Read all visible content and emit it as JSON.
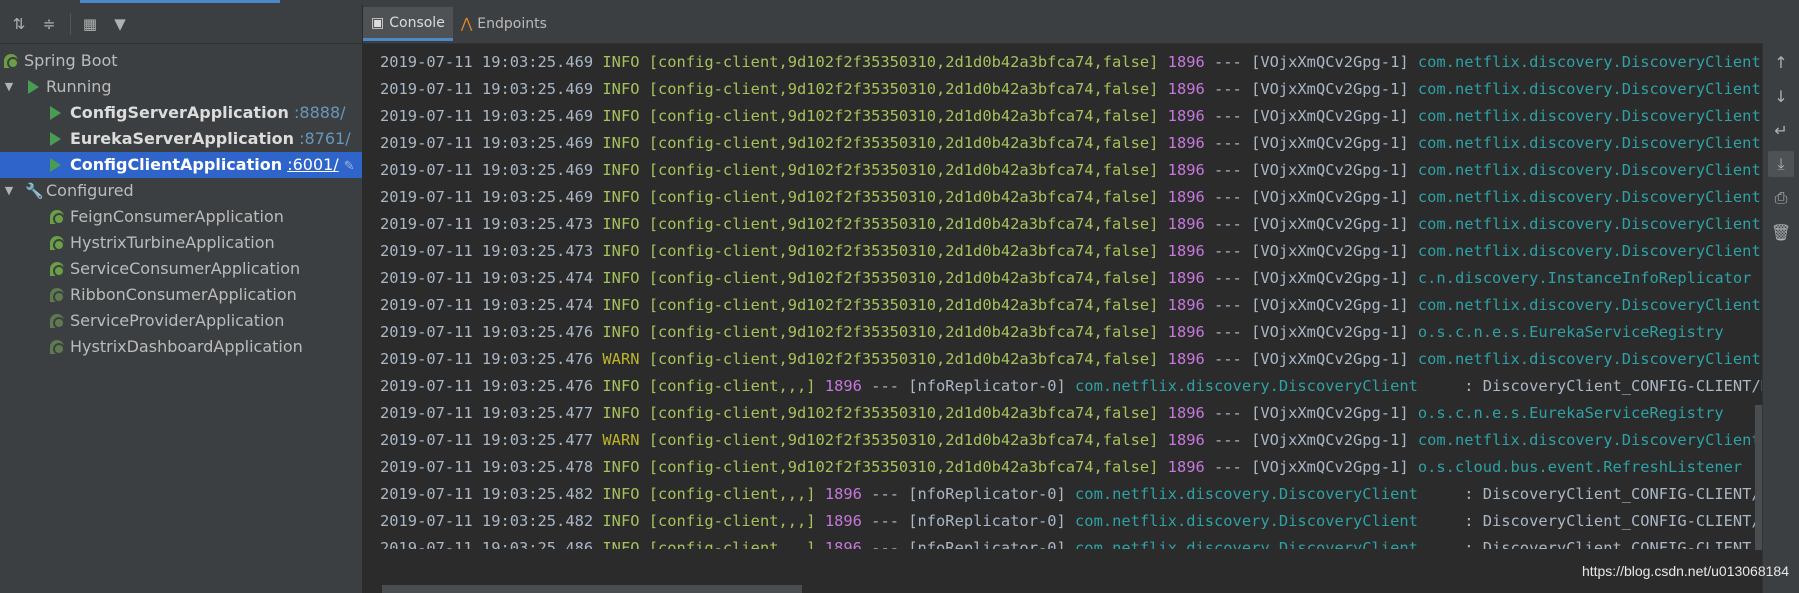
{
  "run_dashboard": {
    "toolbar": {
      "expand_all_icon": "expand-all-icon",
      "collapse_all_icon": "collapse-all-icon",
      "group_icon": "group-by-icon",
      "filter_icon": "filter-icon"
    },
    "root_label": "Spring Boot",
    "running_label": "Running",
    "running_apps": [
      {
        "name": "ConfigServerApplication",
        "port": ":8888/"
      },
      {
        "name": "EurekaServerApplication",
        "port": ":8761/"
      },
      {
        "name": "ConfigClientApplication",
        "port": ":6001/"
      }
    ],
    "configured_label": "Configured",
    "configured_apps": [
      "FeignConsumerApplication",
      "HystrixTurbineApplication",
      "ServiceConsumerApplication",
      "RibbonConsumerApplication",
      "ServiceProviderApplication",
      "HystrixDashboardApplication"
    ]
  },
  "console": {
    "tabs": [
      {
        "label": "Console",
        "icon": "console-icon"
      },
      {
        "label": "Endpoints",
        "icon": "endpoints-icon"
      }
    ],
    "lines": [
      {
        "ts": "2019-07-11 19:03:25.469",
        "level": "INFO ",
        "ctx": "[config-client,9d102f2f35350310,2d1d0b42a3bfca74,false]",
        "pid": "1896",
        "th": " --- [VOjxXmQCv2Gpg-1] ",
        "cls": "com.netflix.discovery.DiscoveryClient",
        "msg": ""
      },
      {
        "ts": "2019-07-11 19:03:25.469",
        "level": "INFO ",
        "ctx": "[config-client,9d102f2f35350310,2d1d0b42a3bfca74,false]",
        "pid": "1896",
        "th": " --- [VOjxXmQCv2Gpg-1] ",
        "cls": "com.netflix.discovery.DiscoveryClient",
        "msg": ""
      },
      {
        "ts": "2019-07-11 19:03:25.469",
        "level": "INFO ",
        "ctx": "[config-client,9d102f2f35350310,2d1d0b42a3bfca74,false]",
        "pid": "1896",
        "th": " --- [VOjxXmQCv2Gpg-1] ",
        "cls": "com.netflix.discovery.DiscoveryClient",
        "msg": ""
      },
      {
        "ts": "2019-07-11 19:03:25.469",
        "level": "INFO ",
        "ctx": "[config-client,9d102f2f35350310,2d1d0b42a3bfca74,false]",
        "pid": "1896",
        "th": " --- [VOjxXmQCv2Gpg-1] ",
        "cls": "com.netflix.discovery.DiscoveryClient",
        "msg": ""
      },
      {
        "ts": "2019-07-11 19:03:25.469",
        "level": "INFO ",
        "ctx": "[config-client,9d102f2f35350310,2d1d0b42a3bfca74,false]",
        "pid": "1896",
        "th": " --- [VOjxXmQCv2Gpg-1] ",
        "cls": "com.netflix.discovery.DiscoveryClient",
        "msg": ""
      },
      {
        "ts": "2019-07-11 19:03:25.469",
        "level": "INFO ",
        "ctx": "[config-client,9d102f2f35350310,2d1d0b42a3bfca74,false]",
        "pid": "1896",
        "th": " --- [VOjxXmQCv2Gpg-1] ",
        "cls": "com.netflix.discovery.DiscoveryClient",
        "msg": ""
      },
      {
        "ts": "2019-07-11 19:03:25.473",
        "level": "INFO ",
        "ctx": "[config-client,9d102f2f35350310,2d1d0b42a3bfca74,false]",
        "pid": "1896",
        "th": " --- [VOjxXmQCv2Gpg-1] ",
        "cls": "com.netflix.discovery.DiscoveryClient",
        "msg": ""
      },
      {
        "ts": "2019-07-11 19:03:25.473",
        "level": "INFO ",
        "ctx": "[config-client,9d102f2f35350310,2d1d0b42a3bfca74,false]",
        "pid": "1896",
        "th": " --- [VOjxXmQCv2Gpg-1] ",
        "cls": "com.netflix.discovery.DiscoveryClient",
        "msg": ""
      },
      {
        "ts": "2019-07-11 19:03:25.474",
        "level": "INFO ",
        "ctx": "[config-client,9d102f2f35350310,2d1d0b42a3bfca74,false]",
        "pid": "1896",
        "th": " --- [VOjxXmQCv2Gpg-1] ",
        "cls": "c.n.discovery.InstanceInfoReplicator",
        "msg": ""
      },
      {
        "ts": "2019-07-11 19:03:25.474",
        "level": "INFO ",
        "ctx": "[config-client,9d102f2f35350310,2d1d0b42a3bfca74,false]",
        "pid": "1896",
        "th": " --- [VOjxXmQCv2Gpg-1] ",
        "cls": "com.netflix.discovery.DiscoveryClient",
        "msg": ""
      },
      {
        "ts": "2019-07-11 19:03:25.476",
        "level": "INFO ",
        "ctx": "[config-client,9d102f2f35350310,2d1d0b42a3bfca74,false]",
        "pid": "1896",
        "th": " --- [VOjxXmQCv2Gpg-1] ",
        "cls": "o.s.c.n.e.s.EurekaServiceRegistry",
        "msg": ""
      },
      {
        "ts": "2019-07-11 19:03:25.476",
        "level": "WARN ",
        "ctx": "[config-client,9d102f2f35350310,2d1d0b42a3bfca74,false]",
        "pid": "1896",
        "th": " --- [VOjxXmQCv2Gpg-1] ",
        "cls": "com.netflix.discovery.DiscoveryClient",
        "msg": ""
      },
      {
        "ts": "2019-07-11 19:03:25.476",
        "level": "INFO ",
        "ctx": "[config-client,,,]",
        "pid": "1896",
        "th": " --- [nfoReplicator-0] ",
        "cls": "com.netflix.discovery.DiscoveryClient",
        "msg": "     : DiscoveryClient_CONFIG-CLIENT/DESKT"
      },
      {
        "ts": "2019-07-11 19:03:25.477",
        "level": "INFO ",
        "ctx": "[config-client,9d102f2f35350310,2d1d0b42a3bfca74,false]",
        "pid": "1896",
        "th": " --- [VOjxXmQCv2Gpg-1] ",
        "cls": "o.s.c.n.e.s.EurekaServiceRegistry",
        "msg": ""
      },
      {
        "ts": "2019-07-11 19:03:25.477",
        "level": "WARN ",
        "ctx": "[config-client,9d102f2f35350310,2d1d0b42a3bfca74,false]",
        "pid": "1896",
        "th": " --- [VOjxXmQCv2Gpg-1] ",
        "cls": "com.netflix.discovery.DiscoveryClient",
        "msg": ""
      },
      {
        "ts": "2019-07-11 19:03:25.478",
        "level": "INFO ",
        "ctx": "[config-client,9d102f2f35350310,2d1d0b42a3bfca74,false]",
        "pid": "1896",
        "th": " --- [VOjxXmQCv2Gpg-1] ",
        "cls": "o.s.cloud.bus.event.RefreshListener",
        "msg": ""
      },
      {
        "ts": "2019-07-11 19:03:25.482",
        "level": "INFO ",
        "ctx": "[config-client,,,]",
        "pid": "1896",
        "th": " --- [nfoReplicator-0] ",
        "cls": "com.netflix.discovery.DiscoveryClient",
        "msg": "     : DiscoveryClient_CONFIG-CLIENT/DESKT"
      },
      {
        "ts": "2019-07-11 19:03:25.482",
        "level": "INFO ",
        "ctx": "[config-client,,,]",
        "pid": "1896",
        "th": " --- [nfoReplicator-0] ",
        "cls": "com.netflix.discovery.DiscoveryClient",
        "msg": "     : DiscoveryClient_CONFIG-CLIENT/DESKT"
      },
      {
        "ts": "2019-07-11 19:03:25.486",
        "level": "INFO ",
        "ctx": "[config-client,,,]",
        "pid": "1896",
        "th": " --- [nfoReplicator-0] ",
        "cls": "com.netflix.discovery.DiscoveryClient",
        "msg": "     : DiscoveryClient_CONFIG-CLIENT/DESKT"
      }
    ],
    "side_toolbar": [
      "up-arrow-icon",
      "down-arrow-icon",
      "soft-wrap-icon",
      "scroll-to-end-icon",
      "print-icon",
      "trash-icon"
    ]
  },
  "watermark": "https://blog.csdn.net/u013068184",
  "colors": {
    "background": "#2b2b2b",
    "panel": "#3c3f41",
    "selection": "#2f65ca",
    "info": "#a5c25c",
    "warn": "#bbb529",
    "pid": "#c678dd",
    "logger": "#2ea1a5",
    "port": "#6897bb"
  }
}
